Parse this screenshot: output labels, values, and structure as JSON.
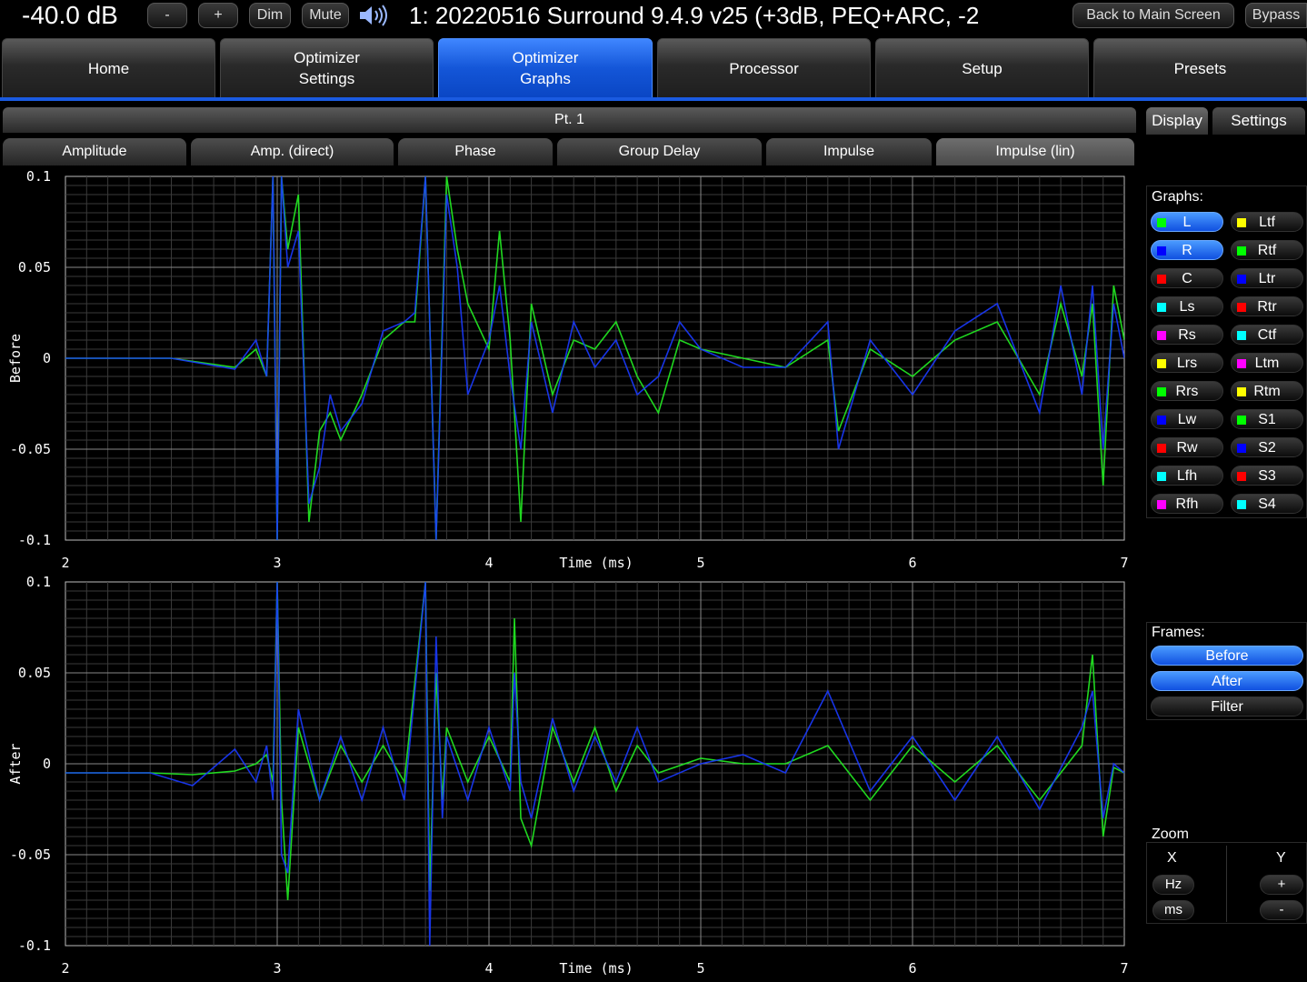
{
  "topbar": {
    "volume": "-40.0 dB",
    "minus": "-",
    "plus": "+",
    "dim": "Dim",
    "mute": "Mute",
    "title": "1: 20220516 Surround 9.4.9 v25 (+3dB, PEQ+ARC, -2",
    "back": "Back to Main Screen",
    "bypass": "Bypass"
  },
  "tabs": [
    {
      "label": "Home"
    },
    {
      "label": "Optimizer\nSettings"
    },
    {
      "label": "Optimizer\nGraphs"
    },
    {
      "label": "Processor"
    },
    {
      "label": "Setup"
    },
    {
      "label": "Presets"
    }
  ],
  "point": "Pt. 1",
  "subtabs": [
    "Amplitude",
    "Amp. (direct)",
    "Phase",
    "Group Delay",
    "Impulse",
    "Impulse (lin)"
  ],
  "right": {
    "display_tab": "Display",
    "settings_tab": "Settings",
    "graphs_label": "Graphs:",
    "graphs_left": [
      {
        "label": "L",
        "color": "#00ff00",
        "on": true
      },
      {
        "label": "R",
        "color": "#0000ff",
        "on": true
      },
      {
        "label": "C",
        "color": "#ff0000",
        "on": false
      },
      {
        "label": "Ls",
        "color": "#00ffff",
        "on": false
      },
      {
        "label": "Rs",
        "color": "#ff00ff",
        "on": false
      },
      {
        "label": "Lrs",
        "color": "#ffff00",
        "on": false
      },
      {
        "label": "Rrs",
        "color": "#00ff00",
        "on": false
      },
      {
        "label": "Lw",
        "color": "#0000ff",
        "on": false
      },
      {
        "label": "Rw",
        "color": "#ff0000",
        "on": false
      },
      {
        "label": "Lfh",
        "color": "#00ffff",
        "on": false
      },
      {
        "label": "Rfh",
        "color": "#ff00ff",
        "on": false
      }
    ],
    "graphs_right": [
      {
        "label": "Ltf",
        "color": "#ffff00",
        "on": false
      },
      {
        "label": "Rtf",
        "color": "#00ff00",
        "on": false
      },
      {
        "label": "Ltr",
        "color": "#0000ff",
        "on": false
      },
      {
        "label": "Rtr",
        "color": "#ff0000",
        "on": false
      },
      {
        "label": "Ctf",
        "color": "#00ffff",
        "on": false
      },
      {
        "label": "Ltm",
        "color": "#ff00ff",
        "on": false
      },
      {
        "label": "Rtm",
        "color": "#ffff00",
        "on": false
      },
      {
        "label": "S1",
        "color": "#00ff00",
        "on": false
      },
      {
        "label": "S2",
        "color": "#0000ff",
        "on": false
      },
      {
        "label": "S3",
        "color": "#ff0000",
        "on": false
      },
      {
        "label": "S4",
        "color": "#00ffff",
        "on": false
      }
    ],
    "frames_label": "Frames:",
    "frames": [
      {
        "label": "Before",
        "on": true
      },
      {
        "label": "After",
        "on": true
      },
      {
        "label": "Filter",
        "on": false
      }
    ],
    "zoom_label": "Zoom",
    "zoom_x": "X",
    "zoom_y": "Y",
    "zoom_hz": "Hz",
    "zoom_ms": "ms",
    "zoom_plus": "+",
    "zoom_minus": "-"
  },
  "chart_data": [
    {
      "type": "line",
      "ylabel": "Before",
      "xlabel": "Time (ms)",
      "xlim": [
        2,
        7
      ],
      "ylim": [
        -0.1,
        0.1
      ],
      "xticks": [
        "2",
        "3",
        "4",
        "5",
        "6",
        "7"
      ],
      "yticks": [
        "0.1",
        "0.05",
        "0",
        "-0.05",
        "-0.1"
      ],
      "series": [
        {
          "name": "L",
          "color": "#22ee22",
          "x": [
            2.0,
            2.5,
            2.8,
            2.9,
            2.95,
            2.98,
            3.0,
            3.02,
            3.05,
            3.1,
            3.15,
            3.2,
            3.25,
            3.3,
            3.4,
            3.5,
            3.6,
            3.65,
            3.7,
            3.75,
            3.8,
            3.85,
            3.9,
            4.0,
            4.05,
            4.1,
            4.15,
            4.2,
            4.3,
            4.4,
            4.5,
            4.6,
            4.7,
            4.8,
            4.9,
            5.0,
            5.2,
            5.4,
            5.6,
            5.65,
            5.8,
            6.0,
            6.2,
            6.4,
            6.6,
            6.7,
            6.8,
            6.85,
            6.9,
            6.95,
            7.0
          ],
          "y": [
            0,
            0,
            -0.005,
            0.005,
            -0.01,
            0.1,
            -0.1,
            0.1,
            0.06,
            0.09,
            -0.09,
            -0.04,
            -0.03,
            -0.045,
            -0.02,
            0.01,
            0.02,
            0.02,
            0.1,
            -0.1,
            0.1,
            0.06,
            0.03,
            0.005,
            0.07,
            0.01,
            -0.09,
            0.03,
            -0.02,
            0.01,
            0.005,
            0.02,
            -0.01,
            -0.03,
            0.01,
            0.005,
            0,
            -0.005,
            0.01,
            -0.04,
            0.005,
            -0.01,
            0.01,
            0.02,
            -0.02,
            0.03,
            -0.01,
            0.03,
            -0.07,
            0.04,
            0.01
          ]
        },
        {
          "name": "R",
          "color": "#1a3aff",
          "x": [
            2.0,
            2.5,
            2.8,
            2.9,
            2.95,
            2.98,
            3.0,
            3.02,
            3.05,
            3.1,
            3.15,
            3.2,
            3.25,
            3.3,
            3.4,
            3.5,
            3.6,
            3.65,
            3.7,
            3.75,
            3.8,
            3.85,
            3.9,
            4.0,
            4.05,
            4.1,
            4.15,
            4.2,
            4.3,
            4.4,
            4.5,
            4.6,
            4.7,
            4.8,
            4.9,
            5.0,
            5.2,
            5.4,
            5.6,
            5.65,
            5.8,
            6.0,
            6.2,
            6.4,
            6.6,
            6.7,
            6.8,
            6.85,
            6.9,
            6.95,
            7.0
          ],
          "y": [
            0,
            0,
            -0.006,
            0.01,
            -0.01,
            0.1,
            -0.1,
            0.1,
            0.05,
            0.07,
            -0.08,
            -0.06,
            -0.02,
            -0.04,
            -0.025,
            0.015,
            0.02,
            0.025,
            0.1,
            -0.1,
            0.09,
            0.05,
            -0.02,
            0.01,
            0.04,
            -0.01,
            -0.05,
            0.02,
            -0.03,
            0.02,
            -0.005,
            0.01,
            -0.02,
            -0.01,
            0.02,
            0.005,
            -0.005,
            -0.005,
            0.02,
            -0.05,
            0.01,
            -0.02,
            0.015,
            0.03,
            -0.03,
            0.04,
            -0.02,
            0.04,
            -0.05,
            0.03,
            0
          ]
        }
      ]
    },
    {
      "type": "line",
      "ylabel": "After",
      "xlabel": "Time (ms)",
      "xlim": [
        2,
        7
      ],
      "ylim": [
        -0.1,
        0.1
      ],
      "xticks": [
        "2",
        "3",
        "4",
        "5",
        "6",
        "7"
      ],
      "yticks": [
        "0.1",
        "0.05",
        "0",
        "-0.05",
        "-0.1"
      ],
      "series": [
        {
          "name": "L",
          "color": "#22ee22",
          "x": [
            2.0,
            2.4,
            2.6,
            2.8,
            2.9,
            2.95,
            2.98,
            3.0,
            3.02,
            3.05,
            3.1,
            3.2,
            3.3,
            3.4,
            3.5,
            3.6,
            3.7,
            3.72,
            3.75,
            3.78,
            3.8,
            3.9,
            4.0,
            4.1,
            4.12,
            4.15,
            4.2,
            4.3,
            4.4,
            4.5,
            4.6,
            4.7,
            4.8,
            5.0,
            5.2,
            5.4,
            5.6,
            5.8,
            6.0,
            6.2,
            6.4,
            6.6,
            6.8,
            6.85,
            6.9,
            6.95,
            7.0
          ],
          "y": [
            -0.005,
            -0.005,
            -0.006,
            -0.004,
            0,
            0.005,
            -0.01,
            0.1,
            -0.02,
            -0.075,
            0.02,
            -0.02,
            0.01,
            -0.01,
            0.01,
            -0.01,
            0.1,
            -0.07,
            0.05,
            -0.02,
            0.02,
            -0.01,
            0.015,
            -0.01,
            0.08,
            -0.03,
            -0.045,
            0.02,
            -0.01,
            0.02,
            -0.015,
            0.01,
            -0.005,
            0.003,
            0,
            0,
            0.01,
            -0.02,
            0.01,
            -0.01,
            0.01,
            -0.02,
            0.01,
            0.06,
            -0.04,
            -0.002,
            -0.005
          ]
        },
        {
          "name": "R",
          "color": "#1a3aff",
          "x": [
            2.0,
            2.4,
            2.6,
            2.8,
            2.9,
            2.95,
            2.98,
            3.0,
            3.02,
            3.05,
            3.1,
            3.2,
            3.3,
            3.4,
            3.5,
            3.6,
            3.7,
            3.72,
            3.75,
            3.78,
            3.8,
            3.9,
            4.0,
            4.1,
            4.12,
            4.15,
            4.2,
            4.3,
            4.4,
            4.5,
            4.6,
            4.7,
            4.8,
            5.0,
            5.2,
            5.4,
            5.6,
            5.8,
            6.0,
            6.2,
            6.4,
            6.6,
            6.8,
            6.85,
            6.9,
            6.95,
            7.0
          ],
          "y": [
            -0.005,
            -0.005,
            -0.012,
            0.008,
            -0.01,
            0.01,
            -0.02,
            0.1,
            -0.05,
            -0.06,
            0.03,
            -0.02,
            0.015,
            -0.02,
            0.02,
            -0.02,
            0.1,
            -0.1,
            0.07,
            -0.03,
            0.015,
            -0.02,
            0.02,
            -0.015,
            0.05,
            -0.01,
            -0.03,
            0.025,
            -0.015,
            0.015,
            -0.01,
            0.02,
            -0.01,
            0,
            0.005,
            -0.005,
            0.04,
            -0.015,
            0.015,
            -0.02,
            0.015,
            -0.025,
            0.02,
            0.04,
            -0.03,
            0,
            -0.005
          ]
        }
      ]
    }
  ]
}
